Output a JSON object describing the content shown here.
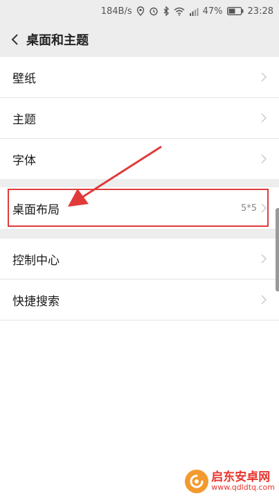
{
  "status_bar": {
    "speed": "184B/s",
    "battery_percent": "47%",
    "time": "23:28",
    "icons": [
      "location-icon",
      "alarm-icon",
      "bluetooth-icon",
      "wifi-icon",
      "signal-icon",
      "battery-icon"
    ]
  },
  "header": {
    "title": "桌面和主题"
  },
  "settings": {
    "items": [
      {
        "label": "壁纸",
        "value": ""
      },
      {
        "label": "主题",
        "value": ""
      },
      {
        "label": "字体",
        "value": ""
      },
      {
        "label": "桌面布局",
        "value": "5*5"
      },
      {
        "label": "控制中心",
        "value": ""
      },
      {
        "label": "快捷搜索",
        "value": ""
      }
    ]
  },
  "annotation": {
    "highlight_color": "#e03a3a"
  },
  "watermark": {
    "title": "启东安卓网",
    "url": "www.qdldtq.com"
  }
}
